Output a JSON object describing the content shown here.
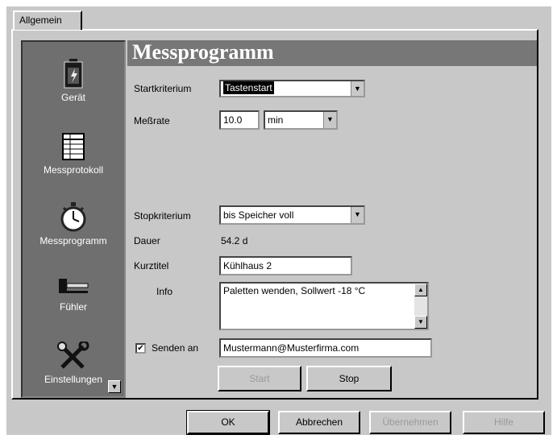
{
  "tab": {
    "label": "Allgemein"
  },
  "nav": {
    "items": [
      {
        "label": "Gerät",
        "icon": "battery-icon"
      },
      {
        "label": "Messprotokoll",
        "icon": "table-icon"
      },
      {
        "label": "Messprogramm",
        "icon": "stopwatch-icon"
      },
      {
        "label": "Fühler",
        "icon": "probe-icon"
      },
      {
        "label": "Einstellungen",
        "icon": "tools-icon"
      }
    ],
    "scroll_glyph": "▼"
  },
  "main": {
    "title": "Messprogramm",
    "startkriterium": {
      "label": "Startkriterium",
      "value": "Tastenstart"
    },
    "messrate": {
      "label": "Meßrate",
      "value": "10.0",
      "unit": "min"
    },
    "stopkriterium": {
      "label": "Stopkriterium",
      "value": "bis Speicher voll"
    },
    "dauer": {
      "label": "Dauer",
      "value": "54.2 d"
    },
    "kurztitel": {
      "label": "Kurztitel",
      "value": "Kühlhaus 2"
    },
    "info": {
      "label": "Info",
      "value": "Paletten wenden, Sollwert -18 °C"
    },
    "senden": {
      "label": "Senden an",
      "checked": true,
      "value": "Mustermann@Musterfirma.com"
    },
    "start_label": "Start",
    "stop_label": "Stop"
  },
  "footer": {
    "ok_label": "OK",
    "cancel_label": "Abbrechen",
    "apply_label": "Übernehmen",
    "help_label": "Hilfe"
  },
  "glyphs": {
    "dropdown": "▼",
    "up": "▲",
    "down": "▼",
    "check": "✔"
  }
}
